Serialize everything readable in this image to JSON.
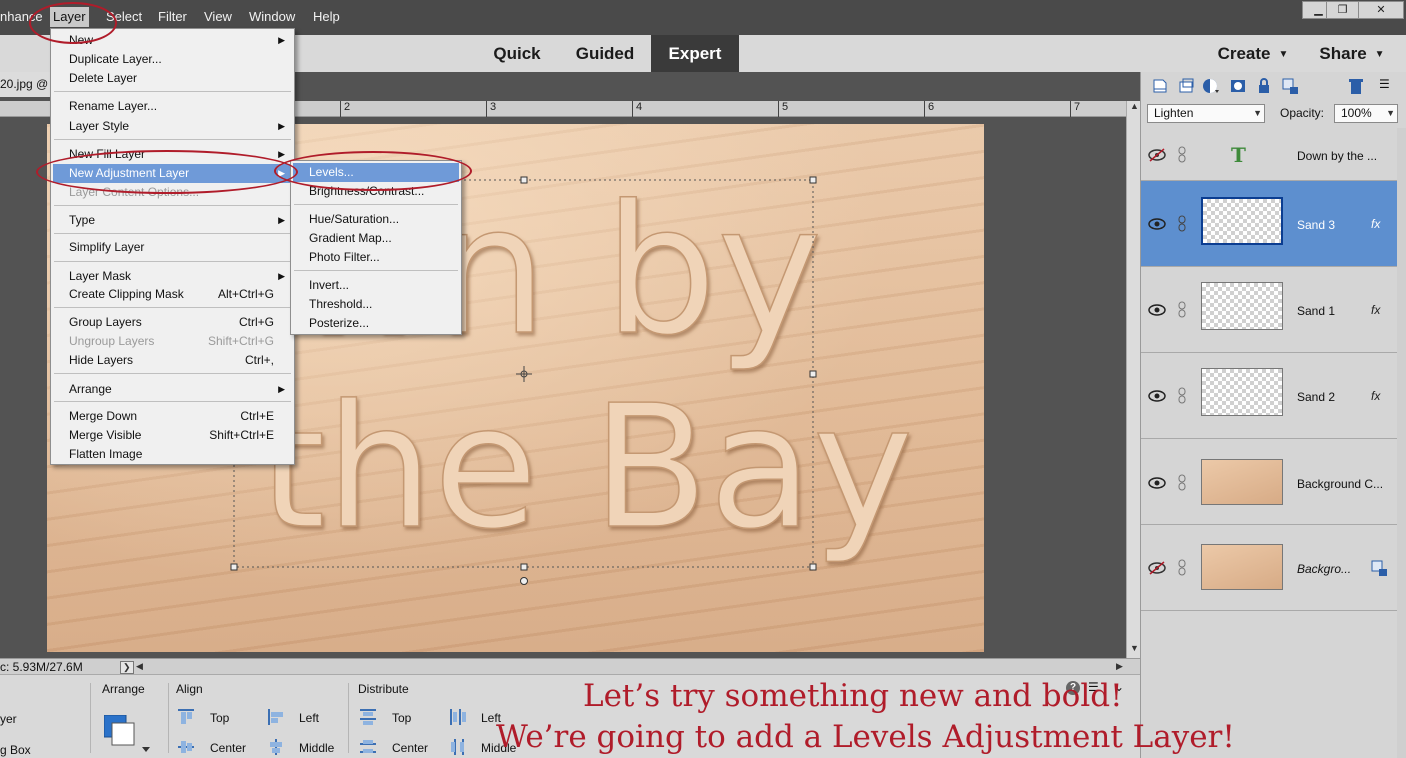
{
  "menubar": {
    "items": [
      "nhance",
      "Layer",
      "Select",
      "Filter",
      "View",
      "Window",
      "Help"
    ],
    "active": "Layer",
    "window_controls": [
      "▁",
      "❐",
      "✕"
    ]
  },
  "modes": {
    "tabs": [
      "Quick",
      "Guided",
      "Expert"
    ],
    "active": "Expert",
    "create": "Create",
    "share": "Share"
  },
  "document": {
    "tab_title": "20.jpg @",
    "ruler_labels": [
      "2",
      "3",
      "4",
      "5",
      "6",
      "7"
    ],
    "status": "c: 5.93M/27.6M"
  },
  "layer_menu": {
    "items": [
      {
        "label": "New",
        "submenu": true
      },
      {
        "label": "Duplicate Layer..."
      },
      {
        "label": "Delete Layer"
      },
      {
        "label": "Rename Layer..."
      },
      {
        "label": "Layer Style",
        "submenu": true
      },
      {
        "label": "New Fill Layer",
        "submenu": true
      },
      {
        "label": "New Adjustment Layer",
        "submenu": true,
        "highlight": true
      },
      {
        "label": "Layer Content Options...",
        "disabled": true
      },
      {
        "label": "Type",
        "submenu": true
      },
      {
        "label": "Simplify Layer"
      },
      {
        "label": "Layer Mask",
        "submenu": true
      },
      {
        "label": "Create Clipping Mask",
        "shortcut": "Alt+Ctrl+G"
      },
      {
        "label": "Group Layers",
        "shortcut": "Ctrl+G"
      },
      {
        "label": "Ungroup Layers",
        "shortcut": "Shift+Ctrl+G",
        "disabled": true
      },
      {
        "label": "Hide Layers",
        "shortcut": "Ctrl+,"
      },
      {
        "label": "Arrange",
        "submenu": true
      },
      {
        "label": "Merge Down",
        "shortcut": "Ctrl+E"
      },
      {
        "label": "Merge Visible",
        "shortcut": "Shift+Ctrl+E"
      },
      {
        "label": "Flatten Image"
      }
    ]
  },
  "adjustment_submenu": {
    "items": [
      {
        "label": "Levels...",
        "highlight": true
      },
      {
        "label": "Brightness/Contrast..."
      },
      {
        "label": "Hue/Saturation..."
      },
      {
        "label": "Gradient Map..."
      },
      {
        "label": "Photo Filter..."
      },
      {
        "label": "Invert..."
      },
      {
        "label": "Threshold..."
      },
      {
        "label": "Posterize..."
      }
    ]
  },
  "layers_panel": {
    "blend_mode": "Lighten",
    "opacity_label": "Opacity:",
    "opacity_value": "100%",
    "layers": [
      {
        "name": "Down by the ...",
        "visible": false,
        "kind": "text",
        "fx": false
      },
      {
        "name": "Sand 3",
        "visible": true,
        "kind": "transparent",
        "fx": true,
        "selected": true
      },
      {
        "name": "Sand 1",
        "visible": true,
        "kind": "transparent",
        "fx": true
      },
      {
        "name": "Sand 2",
        "visible": true,
        "kind": "transparent",
        "fx": true
      },
      {
        "name": "Background C...",
        "visible": true,
        "kind": "sand",
        "fx": false
      },
      {
        "name": "Backgro...",
        "visible": false,
        "kind": "sand",
        "fx": false,
        "italic": true
      }
    ],
    "fx_label": "fx"
  },
  "tool_options": {
    "left_labels": [
      "yer",
      "g Box"
    ],
    "arrange_label": "Arrange",
    "align_label": "Align",
    "distribute_label": "Distribute",
    "align": {
      "top": "Top",
      "center": "Center",
      "left": "Left",
      "middle": "Middle"
    },
    "distribute": {
      "top": "Top",
      "center": "Center",
      "left": "Left",
      "middle": "Middle"
    }
  },
  "canvas_text": {
    "line1": "wn by",
    "line2": "the Bay"
  },
  "caption": {
    "line1": "Let’s try something new and bold!",
    "line2": "We’re going to add a Levels Adjustment Layer!"
  },
  "colors": {
    "annotation": "#b01c2a",
    "highlight": "#6f9ad8",
    "selected_layer": "#5d8fcf",
    "sand": "#dfb692"
  }
}
